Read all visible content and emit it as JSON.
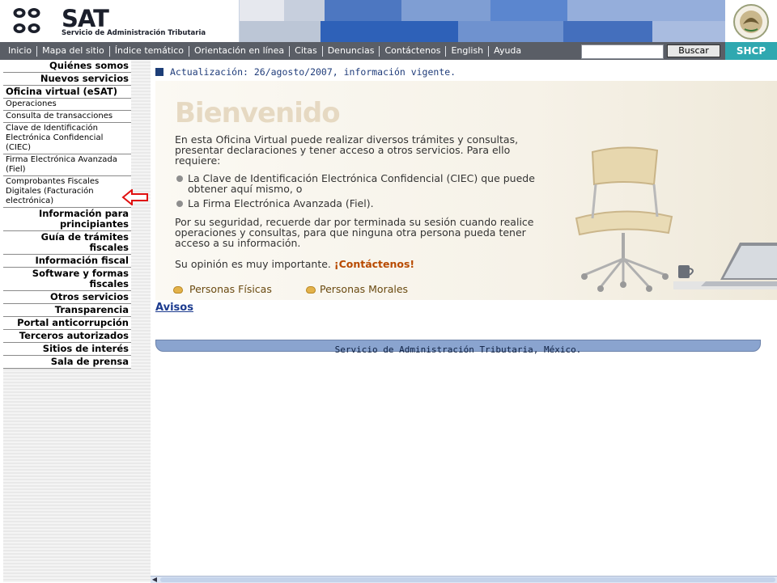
{
  "header": {
    "logo_name": "SAT",
    "logo_subtitle": "Servicio de Administración Tributaria",
    "brand_colors": {
      "banner": "#5f86c6",
      "nav": "#5a5e66",
      "shcp": "#2fa8b0"
    }
  },
  "nav": {
    "items": [
      "Inicio",
      "Mapa del sitio",
      "Índice temático",
      "Orientación en línea",
      "Citas",
      "Denuncias",
      "Contáctenos",
      "English",
      "Ayuda"
    ],
    "search_placeholder": "",
    "search_button": "Buscar",
    "shcp_label": "SHCP"
  },
  "sidebar": {
    "items": [
      "Quiénes somos",
      "Nuevos servicios",
      "Oficina virtual (eSAT)",
      "Operaciones",
      "Consulta de transacciones",
      "Clave de Identificación Electrónica Confidencial (CIEC)",
      "Firma Electrónica Avanzada (Fiel)",
      "Comprobantes Fiscales Digitales (Facturación electrónica)",
      "Información para principiantes",
      "Guía de trámites fiscales",
      "Información fiscal",
      "Software y formas fiscales",
      "Otros servicios",
      "Transparencia",
      "Portal anticorrupción",
      "Terceros autorizados",
      "Sitios de interés",
      "Sala de prensa"
    ],
    "arrow_icon": "left-arrow-icon"
  },
  "main": {
    "update_text": "Actualización: 26/agosto/2007, información vigente.",
    "welcome_title": "Bienvenido",
    "intro": "En esta Oficina Virtual puede realizar diversos trámites y consultas, presentar declaraciones y tener acceso a otros servicios. Para ello requiere:",
    "bullets": [
      "La Clave de Identificación Electrónica Confidencial (CIEC) que puede obtener aquí mismo, o",
      "La Firma Electrónica Avanzada (Fiel)."
    ],
    "security": "Por su seguridad, recuerde dar por terminada su sesión cuando realice operaciones y consultas, para que ninguna otra persona pueda tener acceso a su información.",
    "opinion": "Su opinión es muy importante.",
    "opinion_link": "¡Contáctenos!",
    "person_links": [
      "Personas Físicas",
      "Personas Morales"
    ],
    "avisos": "Avisos",
    "footer": "Servicio de Administración Tributaria, México."
  }
}
